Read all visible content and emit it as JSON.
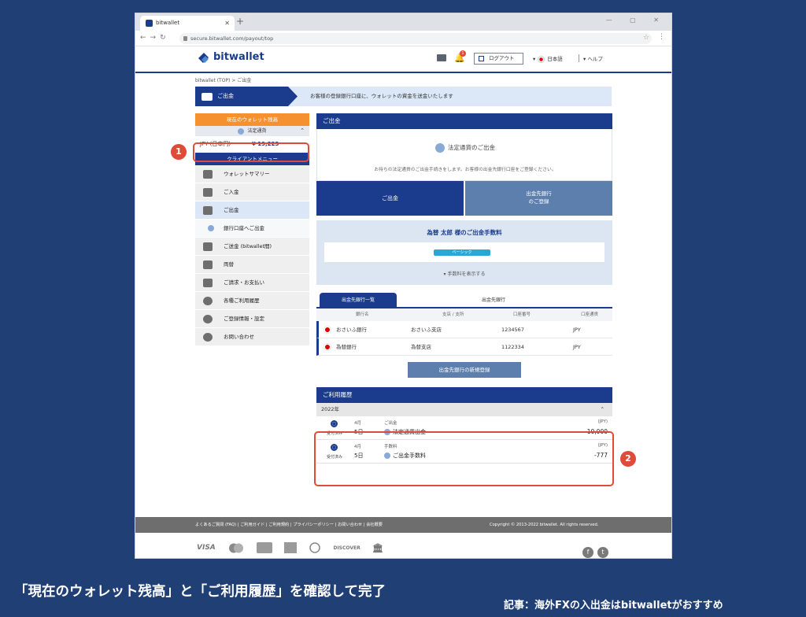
{
  "browser": {
    "tab_title": "bitwallet",
    "url": "secure.bitwallet.com/payout/top"
  },
  "header": {
    "brand": "bitwallet",
    "notification_count": "1",
    "logout_label": "ログアウト",
    "language": "日本語",
    "help": "ヘルプ"
  },
  "breadcrumb": "bitwallet (TOP)  >  ご出金",
  "banner": {
    "label": "ご出金",
    "text": "お客様の登録銀行口座に、ウォレットの資金を送金いたします"
  },
  "sidebar": {
    "balance_header": "現在のウォレット残高",
    "balance_sub": "法定通貨",
    "balance_currency": "JPY (日本円)",
    "balance_amount": "¥ 19,223",
    "menu_header": "クライアントメニュー",
    "items": [
      {
        "label": "ウォレットサマリー",
        "icon": "building-icon"
      },
      {
        "label": "ご入金",
        "icon": "deposit-icon"
      },
      {
        "label": "ご出金",
        "icon": "withdraw-icon"
      },
      {
        "label": "銀行口座へご出金",
        "icon": "bank-dot-icon"
      },
      {
        "label": "ご送金 (bitwallet間)",
        "icon": "transfer-icon"
      },
      {
        "label": "両替",
        "icon": "exchange-icon"
      },
      {
        "label": "ご請求・お支払い",
        "icon": "invoice-icon"
      },
      {
        "label": "各種ご利用履歴",
        "icon": "history-icon"
      },
      {
        "label": "ご登録情報・設定",
        "icon": "gear-icon"
      },
      {
        "label": "お問い合わせ",
        "icon": "help-icon"
      }
    ]
  },
  "main": {
    "section_title": "ご出金",
    "wd_title": "法定通貨のご出金",
    "wd_desc": "お持ちの法定通貨のご出金手続きをします。お客様の出金先銀行口座をご登録ください。",
    "btn_withdraw": "ご出金",
    "btn_register_1": "出金先銀行",
    "btn_register_2": "のご登録",
    "fee_title": "為替 太郎 様のご出金手数料",
    "fee_pill": "ベーシック",
    "fee_more": "手数料を表示する",
    "bank_tab_1": "出金先銀行一覧",
    "bank_tab_2": "出金先銀行",
    "bank_headers": [
      "銀行名",
      "支店 / 支所",
      "口座番号",
      "口座通貨"
    ],
    "banks": [
      {
        "name": "おさいふ銀行",
        "branch": "おさいふ支店",
        "account": "1234567",
        "currency": "JPY"
      },
      {
        "name": "為替銀行",
        "branch": "為替支店",
        "account": "1122334",
        "currency": "JPY"
      }
    ],
    "new_bank_btn": "出金先銀行の新規登録",
    "history_title": "ご利用履歴",
    "year": "2022年",
    "history": [
      {
        "status": "受付済み",
        "month": "4月",
        "day": "5日",
        "type": "ご出金",
        "name": "法定通貨出金",
        "currency": "(JPY)",
        "amount": "-10,000"
      },
      {
        "status": "受付済み",
        "month": "4月",
        "day": "5日",
        "type": "手数料",
        "name": "ご出金手数料",
        "currency": "(JPY)",
        "amount": "-777"
      }
    ]
  },
  "footer": {
    "links": "よくあるご質問 (FAQ)  |  ご利用ガイド  |  ご利用規約  |  プライバシーポリシー  |  お問い合わせ  |  会社概要",
    "copyright": "Copyright © 2013-2022 bitwallet. All rights reserved.",
    "payments": [
      "VISA",
      "Mastercard",
      "JCB",
      "AMEX",
      "Diners Club",
      "DISCOVER",
      "Bank"
    ]
  },
  "annotations": {
    "callout_1": "1",
    "callout_2": "2",
    "caption": "「現在のウォレット残高」と「ご利用履歴」を確認して完了",
    "article": "記事：海外FXの入出金はbitwalletがおすすめ"
  },
  "colors": {
    "brand": "#1b3c8c",
    "accent": "#f5922f",
    "callout": "#e04b39",
    "background": "#1f3f75"
  }
}
